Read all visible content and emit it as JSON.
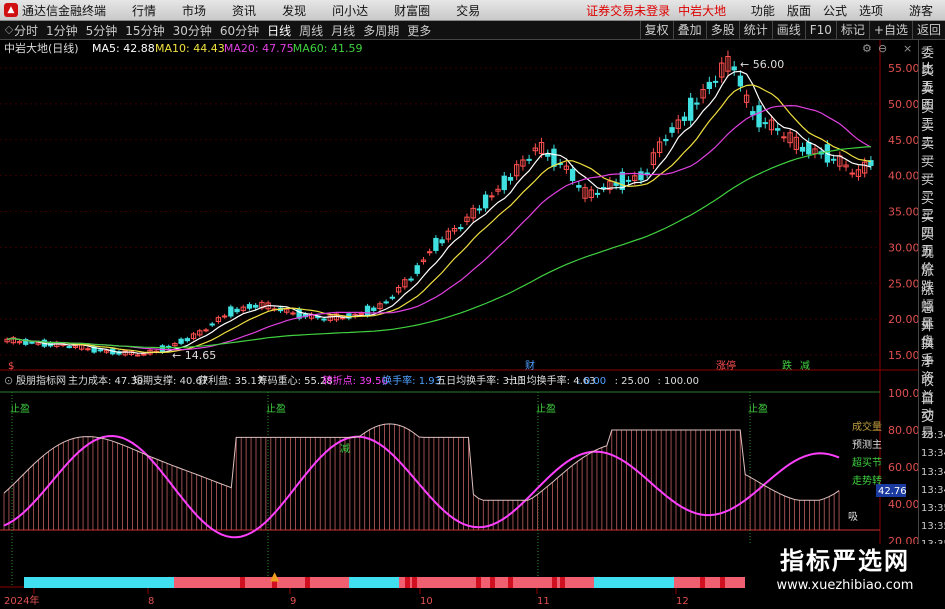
{
  "menubar": {
    "app_title": "通达信金融终端",
    "items": [
      "行情",
      "市场",
      "资讯",
      "发现",
      "问小达",
      "财富圈",
      "交易"
    ],
    "warning": "证券交易未登录",
    "stock": "中岩大地",
    "right": [
      "功能",
      "版面",
      "公式",
      "选项"
    ],
    "guest": "游客"
  },
  "toolbar": {
    "periods": [
      "分时",
      "1分钟",
      "5分钟",
      "15分钟",
      "30分钟",
      "60分钟",
      "日线",
      "周线",
      "月线",
      "多周期",
      "更多"
    ],
    "active": "日线",
    "right": [
      "复权",
      "叠加",
      "多股",
      "统计",
      "画线",
      "F10",
      "标记",
      "+自选",
      "返回"
    ]
  },
  "main_header": {
    "stock": "中岩大地(日线)",
    "items": [
      {
        "label": "MA5: 42.88",
        "color": "#ffffff"
      },
      {
        "label": "MA10: 44.43",
        "color": "#f0e040"
      },
      {
        "label": "MA20: 47.75",
        "color": "#e040e0"
      },
      {
        "label": "MA60: 41.59",
        "color": "#40d040"
      }
    ]
  },
  "price_axis": {
    "labels": [
      "55.00",
      "50.00",
      "45.00",
      "40.00",
      "35.00",
      "30.00",
      "25.00",
      "20.00",
      "15.00"
    ]
  },
  "annotations": {
    "high": "56.00",
    "low": "14.65"
  },
  "markers": [
    {
      "label": "财",
      "color": "#4fa0ff"
    },
    {
      "label": "涨停",
      "color": "#ff5050"
    },
    {
      "label": "跌",
      "color": "#40d040"
    },
    {
      "label": "减",
      "color": "#40d040"
    }
  ],
  "sub_header": {
    "name": "殷朋指标网",
    "items": [
      {
        "label": "主力成本: 47.30",
        "color": "#dddddd"
      },
      {
        "label": "短期支撑: 40.67",
        "color": "#dddddd"
      },
      {
        "label": "获利盘: 35.17",
        "color": "#dddddd"
      },
      {
        "label": "筹码重心: 55.28",
        "color": "#dddddd"
      },
      {
        "label": "转折点: 39.50",
        "color": "#ff40ff"
      },
      {
        "label": "换手率: 1.93",
        "color": "#4fa0ff"
      },
      {
        "label": "五日均换手率: 3.11",
        "color": "#dddddd"
      },
      {
        "label": "十日均换手率: 4.63",
        "color": "#dddddd"
      },
      {
        "label": ": 0.00",
        "color": "#4fa0ff"
      },
      {
        "label": ": 25.00",
        "color": "#dddddd"
      },
      {
        "label": ": 100.00",
        "color": "#dddddd"
      }
    ]
  },
  "sub_axis": {
    "labels": [
      "100.00",
      "80.00",
      "60.00",
      "40.00",
      "20.00"
    ],
    "current": "42.76"
  },
  "sub_signals": [
    "止盈",
    "止盈",
    "止盈",
    "止盈"
  ],
  "sub_marks": {
    "fill": "减",
    "buy": "吸"
  },
  "sub_legend": [
    "成交量",
    "预测主",
    "超买节",
    "走势转"
  ],
  "dates": [
    "2024年",
    "8",
    "9",
    "10",
    "11",
    "12"
  ],
  "sidebar": [
    "委比",
    "卖五",
    "卖四",
    "卖三",
    "卖二",
    "卖一",
    "买一",
    "买二",
    "买三",
    "买四",
    "买五",
    "现价",
    "涨跌",
    "涨幅",
    "总量",
    "外盘",
    "换手",
    "净资",
    "收益",
    "自动",
    "交易",
    "13:34",
    "13:34",
    "13:34",
    "13:34",
    "13:35",
    "13:35",
    "13:35"
  ],
  "watermark": {
    "title": "指标严选网",
    "url": "www.xuezhibiao.com"
  },
  "colors": {
    "up": "#ff5050",
    "down": "#40e0e0",
    "ma5": "#ffffff",
    "ma10": "#f0e040",
    "ma20": "#e040e0",
    "ma60": "#40d040",
    "grid": "#8b0000",
    "subline": "#ff40ff"
  }
}
